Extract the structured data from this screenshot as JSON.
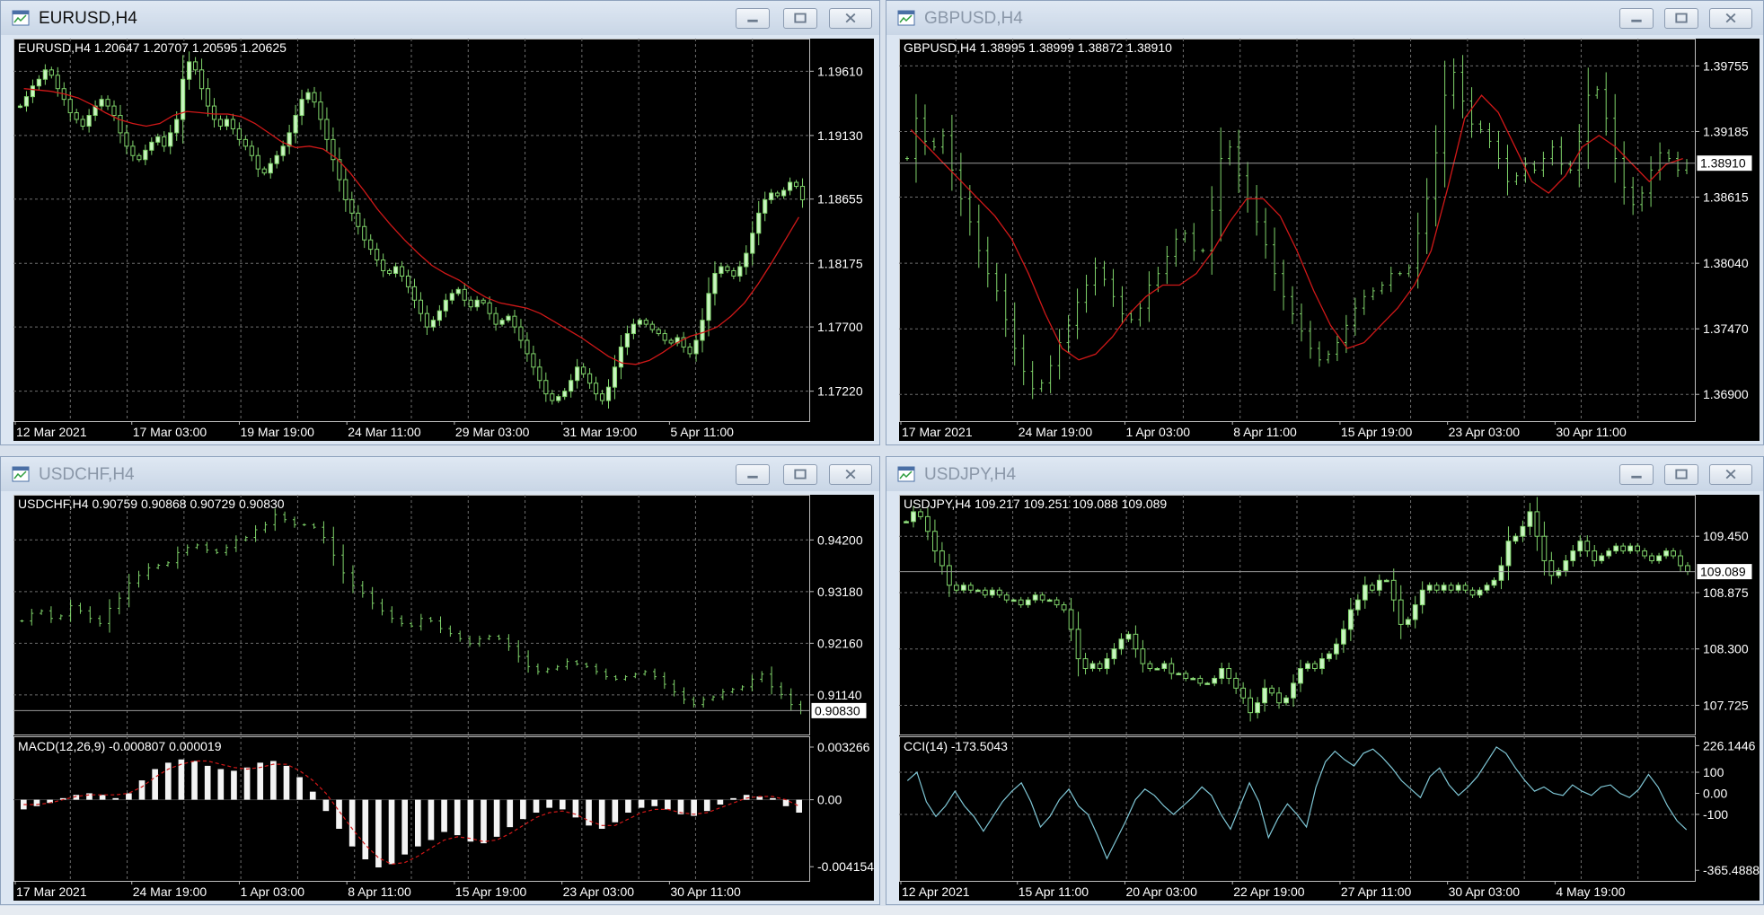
{
  "colors": {
    "background": "#000000",
    "grid": "#6e6e6e",
    "text": "#ffffff",
    "bull_candle": "#c8f5c0",
    "bear_candle": "#4a9a3a",
    "bar_line": "#7fd36a",
    "moving_average": "#d01818",
    "macd_hist": "#f4f4f4",
    "macd_signal": "#d01818",
    "cci_line": "#7fc7d6",
    "close_button_active": "#c94c32"
  },
  "icons": {
    "window_icon": "chart-window-icon",
    "minimize": "minimize-icon",
    "maximize": "maximize-icon",
    "close": "close-icon"
  },
  "windows": [
    {
      "title": "EURUSD,H4",
      "active": true,
      "info": "EURUSD,H4  1.20647 1.20707 1.20595 1.20625",
      "style": "candles",
      "prices": [
        1.1935,
        1.1942,
        1.195,
        1.1955,
        1.1962,
        1.1958,
        1.1948,
        1.194,
        1.193,
        1.1925,
        1.192,
        1.1928,
        1.1935,
        1.194,
        1.1935,
        1.1928,
        1.1915,
        1.1905,
        1.1898,
        1.1895,
        1.1902,
        1.1908,
        1.1912,
        1.1905,
        1.1915,
        1.1925,
        1.1955,
        1.1968,
        1.1962,
        1.1948,
        1.1935,
        1.1925,
        1.192,
        1.1925,
        1.1918,
        1.191,
        1.1905,
        1.1898,
        1.1888,
        1.1885,
        1.1892,
        1.1898,
        1.1905,
        1.1915,
        1.1928,
        1.194,
        1.1945,
        1.1938,
        1.1925,
        1.191,
        1.1895,
        1.188,
        1.1865,
        1.1855,
        1.1845,
        1.1835,
        1.1828,
        1.182,
        1.1812,
        1.181,
        1.1815,
        1.1808,
        1.18,
        1.179,
        1.178,
        1.177,
        1.1775,
        1.1782,
        1.179,
        1.1795,
        1.1798,
        1.179,
        1.1785,
        1.179,
        1.1788,
        1.178,
        1.1772,
        1.1775,
        1.1778,
        1.177,
        1.176,
        1.175,
        1.174,
        1.173,
        1.172,
        1.1715,
        1.1718,
        1.1722,
        1.173,
        1.174,
        1.1735,
        1.1728,
        1.172,
        1.1715,
        1.1725,
        1.174,
        1.1755,
        1.1765,
        1.1772,
        1.1775,
        1.1772,
        1.1768,
        1.1765,
        1.176,
        1.1758,
        1.1762,
        1.1755,
        1.175,
        1.176,
        1.1775,
        1.1795,
        1.181,
        1.1815,
        1.1812,
        1.1808,
        1.1815,
        1.1825,
        1.184,
        1.1855,
        1.1865,
        1.187,
        1.1868,
        1.1872,
        1.1878,
        1.1875,
        1.1865
      ],
      "ma": [
        1.1948,
        1.1947,
        1.1946,
        1.1944,
        1.1941,
        1.1936,
        1.193,
        1.1925,
        1.1922,
        1.192,
        1.1922,
        1.1928,
        1.1931,
        1.193,
        1.1929,
        1.1929,
        1.1927,
        1.1922,
        1.1915,
        1.1908,
        1.1904,
        1.1905,
        1.1903,
        1.1896,
        1.1885,
        1.1872,
        1.1858,
        1.1846,
        1.1835,
        1.1825,
        1.1816,
        1.181,
        1.1805,
        1.1798,
        1.1792,
        1.1788,
        1.1786,
        1.1784,
        1.178,
        1.1774,
        1.1768,
        1.1762,
        1.1755,
        1.1748,
        1.1743,
        1.1742,
        1.1745,
        1.1751,
        1.1758,
        1.1763,
        1.1766,
        1.177,
        1.1778,
        1.1788,
        1.1802,
        1.1818,
        1.1835,
        1.1852
      ],
      "y_range": [
        1.1705,
        1.198
      ],
      "price_ticks": [
        "1.19610",
        "1.19130",
        "1.18655",
        "1.18175",
        "1.17700",
        "1.17220"
      ],
      "price_tick_values": [
        1.1961,
        1.1913,
        1.18655,
        1.18175,
        1.177,
        1.1722
      ],
      "time_labels": [
        "12 Mar 2021",
        "17 Mar 03:00",
        "19 Mar 19:00",
        "24 Mar 11:00",
        "29 Mar 03:00",
        "31 Mar 19:00",
        "5 Apr 11:00"
      ],
      "current_price": null,
      "indicator": null
    },
    {
      "title": "GBPUSD,H4",
      "active": false,
      "info": "GBPUSD,H4  1.38995 1.38999 1.38872 1.38910",
      "style": "bars",
      "prices": [
        1.3895,
        1.393,
        1.391,
        1.3905,
        1.3915,
        1.3885,
        1.386,
        1.384,
        1.3815,
        1.3795,
        1.378,
        1.3755,
        1.373,
        1.371,
        1.3695,
        1.37,
        1.3715,
        1.3735,
        1.375,
        1.377,
        1.3785,
        1.38,
        1.379,
        1.3775,
        1.376,
        1.3755,
        1.3765,
        1.3785,
        1.3795,
        1.381,
        1.3825,
        1.383,
        1.3815,
        1.3815,
        1.385,
        1.3895,
        1.3905,
        1.388,
        1.386,
        1.384,
        1.382,
        1.3795,
        1.3775,
        1.376,
        1.3745,
        1.373,
        1.372,
        1.3725,
        1.3735,
        1.375,
        1.3765,
        1.3775,
        1.378,
        1.3785,
        1.3795,
        1.3795,
        1.38,
        1.383,
        1.386,
        1.39,
        1.395,
        1.397,
        1.3945,
        1.3925,
        1.392,
        1.391,
        1.3895,
        1.3875,
        1.388,
        1.389,
        1.3885,
        1.3895,
        1.3905,
        1.389,
        1.3885,
        1.391,
        1.395,
        1.3955,
        1.393,
        1.3895,
        1.387,
        1.3855,
        1.3865,
        1.3885,
        1.39,
        1.3895,
        1.3885,
        1.3891
      ],
      "ma": [
        1.392,
        1.3905,
        1.389,
        1.3875,
        1.386,
        1.3845,
        1.3825,
        1.3795,
        1.376,
        1.373,
        1.372,
        1.3725,
        1.374,
        1.376,
        1.3775,
        1.3785,
        1.3785,
        1.3795,
        1.3815,
        1.384,
        1.386,
        1.386,
        1.3845,
        1.3815,
        1.378,
        1.375,
        1.373,
        1.3735,
        1.375,
        1.3765,
        1.3785,
        1.3815,
        1.387,
        1.393,
        1.395,
        1.3935,
        1.3905,
        1.3875,
        1.3865,
        1.388,
        1.3905,
        1.3915,
        1.3905,
        1.389,
        1.3875,
        1.389,
        1.3895
      ],
      "y_range": [
        1.3673,
        1.3993
      ],
      "price_ticks": [
        "1.39755",
        "1.39185",
        "1.38615",
        "1.38040",
        "1.37470",
        "1.36900"
      ],
      "price_tick_values": [
        1.39755,
        1.39185,
        1.38615,
        1.3804,
        1.3747,
        1.369
      ],
      "time_labels": [
        "17 Mar 2021",
        "24 Mar 19:00",
        "1 Apr 03:00",
        "8 Apr 11:00",
        "15 Apr 19:00",
        "23 Apr 03:00",
        "30 Apr 11:00"
      ],
      "current_price": "1.38910",
      "current_price_value": 1.3891,
      "indicator": null
    },
    {
      "title": "USDCHF,H4",
      "active": false,
      "info": "USDCHF,H4  0.90759 0.90868 0.90729 0.90830",
      "style": "bars",
      "prices": [
        0.926,
        0.9275,
        0.928,
        0.9265,
        0.927,
        0.929,
        0.928,
        0.9265,
        0.9255,
        0.9285,
        0.9305,
        0.9335,
        0.935,
        0.9365,
        0.937,
        0.9375,
        0.9395,
        0.9405,
        0.941,
        0.94,
        0.9395,
        0.9405,
        0.942,
        0.9425,
        0.944,
        0.945,
        0.947,
        0.946,
        0.945,
        0.945,
        0.9445,
        0.9425,
        0.939,
        0.9355,
        0.933,
        0.9315,
        0.9295,
        0.928,
        0.9265,
        0.9255,
        0.925,
        0.9265,
        0.926,
        0.9245,
        0.9235,
        0.9225,
        0.9215,
        0.9225,
        0.923,
        0.9225,
        0.921,
        0.919,
        0.917,
        0.916,
        0.9165,
        0.917,
        0.918,
        0.9175,
        0.917,
        0.916,
        0.915,
        0.9145,
        0.915,
        0.9155,
        0.916,
        0.915,
        0.9135,
        0.912,
        0.9105,
        0.9095,
        0.9105,
        0.911,
        0.912,
        0.9125,
        0.913,
        0.9145,
        0.9155,
        0.913,
        0.9115,
        0.9095,
        0.9083
      ],
      "y_range": [
        0.905,
        0.9495
      ],
      "price_ticks": [
        "0.94200",
        "0.93180",
        "0.92160",
        "0.91140"
      ],
      "price_tick_values": [
        0.942,
        0.9318,
        0.9216,
        0.9114
      ],
      "time_labels": [
        "17 Mar 2021",
        "24 Mar 19:00",
        "1 Apr 03:00",
        "8 Apr 11:00",
        "15 Apr 19:00",
        "23 Apr 03:00",
        "30 Apr 11:00"
      ],
      "current_price": "0.90830",
      "current_price_value": 0.9083,
      "ma": null,
      "indicator": {
        "type": "macd",
        "label": "MACD(12,26,9) -0.000807 0.000019",
        "ticks": [
          "0.003266",
          "0.00",
          "-0.004154"
        ],
        "tick_values": [
          0.003266,
          0,
          -0.004154
        ],
        "range": [
          -0.0047,
          0.0036
        ],
        "hist": [
          -0.0006,
          -0.0004,
          -0.0002,
          0.0001,
          0.0003,
          0.0004,
          0.0003,
          0.0001,
          0.0004,
          0.0012,
          0.0019,
          0.0023,
          0.0025,
          0.0024,
          0.0021,
          0.0019,
          0.0018,
          0.002,
          0.0023,
          0.0024,
          0.0021,
          0.0014,
          0.0005,
          -0.0007,
          -0.0018,
          -0.0029,
          -0.0037,
          -0.0042,
          -0.004,
          -0.0034,
          -0.0029,
          -0.0025,
          -0.002,
          -0.0022,
          -0.0026,
          -0.0027,
          -0.0023,
          -0.0017,
          -0.0012,
          -0.0008,
          -0.0005,
          -0.0006,
          -0.0011,
          -0.0016,
          -0.0018,
          -0.0014,
          -0.0008,
          -0.0005,
          -0.0004,
          -0.0006,
          -0.0009,
          -0.001,
          -0.0007,
          -0.0003,
          0.0001,
          0.0003,
          0.0002,
          0.0001,
          -0.0004,
          -0.0008
        ],
        "signal": [
          -0.0003,
          -0.0003,
          -0.0002,
          0.0,
          0.0002,
          0.0003,
          0.0003,
          0.0003,
          0.0004,
          0.0008,
          0.0014,
          0.0019,
          0.0022,
          0.0024,
          0.0024,
          0.0022,
          0.002,
          0.0019,
          0.002,
          0.0022,
          0.0022,
          0.0018,
          0.0012,
          0.0004,
          -0.0007,
          -0.0018,
          -0.0028,
          -0.0036,
          -0.004,
          -0.0039,
          -0.0035,
          -0.003,
          -0.0025,
          -0.0023,
          -0.0024,
          -0.0026,
          -0.0025,
          -0.0021,
          -0.0016,
          -0.0011,
          -0.0008,
          -0.0007,
          -0.0009,
          -0.0013,
          -0.0016,
          -0.0016,
          -0.0012,
          -0.0008,
          -0.0006,
          -0.0006,
          -0.0008,
          -0.0009,
          -0.0008,
          -0.0005,
          -0.0002,
          0.0001,
          0.0002,
          0.0002,
          0.0,
          -0.0004
        ]
      }
    },
    {
      "title": "USDJPY,H4",
      "active": false,
      "info": "USDJPY,H4  109.217 109.251 109.088 109.089",
      "style": "candles",
      "prices": [
        109.6,
        109.7,
        109.65,
        109.5,
        109.3,
        109.15,
        108.95,
        108.9,
        108.95,
        108.9,
        108.9,
        108.85,
        108.9,
        108.85,
        108.8,
        108.8,
        108.75,
        108.8,
        108.85,
        108.8,
        108.8,
        108.75,
        108.7,
        108.5,
        108.2,
        108.1,
        108.15,
        108.1,
        108.2,
        108.3,
        108.4,
        108.45,
        108.3,
        108.15,
        108.1,
        108.1,
        108.15,
        108.05,
        108.05,
        108.0,
        108.0,
        107.95,
        107.95,
        108.0,
        108.1,
        108.0,
        107.9,
        107.8,
        107.65,
        107.75,
        107.9,
        107.85,
        107.75,
        107.8,
        107.95,
        108.1,
        108.15,
        108.1,
        108.2,
        108.25,
        108.35,
        108.5,
        108.7,
        108.8,
        108.95,
        108.9,
        109.0,
        109.0,
        108.8,
        108.55,
        108.6,
        108.75,
        108.9,
        108.95,
        108.9,
        108.95,
        108.9,
        108.95,
        108.9,
        108.85,
        108.9,
        108.95,
        109.0,
        109.15,
        109.4,
        109.45,
        109.55,
        109.7,
        109.45,
        109.2,
        109.05,
        109.1,
        109.2,
        109.3,
        109.4,
        109.3,
        109.2,
        109.25,
        109.3,
        109.35,
        109.3,
        109.35,
        109.3,
        109.25,
        109.2,
        109.25,
        109.3,
        109.25,
        109.15,
        109.09
      ],
      "y_range": [
        107.5,
        109.8
      ],
      "price_ticks": [
        "109.450",
        "108.875",
        "108.300",
        "107.725"
      ],
      "price_tick_values": [
        109.45,
        108.875,
        108.3,
        107.725
      ],
      "time_labels": [
        "12 Apr 2021",
        "15 Apr 11:00",
        "20 Apr 03:00",
        "22 Apr 19:00",
        "27 Apr 11:00",
        "30 Apr 03:00",
        "4 May 19:00"
      ],
      "current_price": "109.089",
      "current_price_value": 109.089,
      "ma": null,
      "indicator": {
        "type": "cci",
        "label": "CCI(14) -173.5043",
        "ticks": [
          "226.1446",
          "100",
          "0.00",
          "-100",
          "-365.4888"
        ],
        "tick_values": [
          226.1446,
          100,
          0,
          -100,
          -365.4888
        ],
        "range": [
          -390,
          245
        ],
        "line": [
          60,
          100,
          -40,
          -110,
          -60,
          10,
          -60,
          -110,
          -180,
          -110,
          -40,
          10,
          50,
          -40,
          -160,
          -110,
          -30,
          20,
          -60,
          -100,
          -200,
          -310,
          -220,
          -130,
          -30,
          20,
          -10,
          -60,
          -100,
          -60,
          -20,
          30,
          -10,
          -100,
          -170,
          -60,
          50,
          -40,
          -210,
          -120,
          -50,
          -100,
          -160,
          30,
          150,
          200,
          160,
          130,
          190,
          210,
          170,
          120,
          60,
          20,
          -20,
          80,
          120,
          40,
          -10,
          30,
          80,
          150,
          220,
          190,
          120,
          60,
          10,
          30,
          0,
          -10,
          40,
          10,
          -10,
          30,
          40,
          0,
          -20,
          20,
          90,
          30,
          -60,
          -130,
          -173
        ]
      }
    }
  ]
}
